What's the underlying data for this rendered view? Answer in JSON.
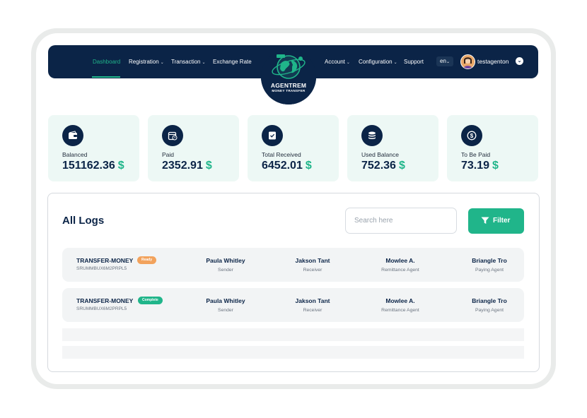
{
  "nav": {
    "left": [
      {
        "label": "Dashboard",
        "has_menu": false,
        "active": true
      },
      {
        "label": "Registration",
        "has_menu": true,
        "active": false
      },
      {
        "label": "Transaction",
        "has_menu": true,
        "active": false
      },
      {
        "label": "Exchange Rate",
        "has_menu": false,
        "active": false
      }
    ],
    "right": [
      {
        "label": "Account",
        "has_menu": true
      },
      {
        "label": "Configuration",
        "has_menu": true
      },
      {
        "label": "Support",
        "has_menu": false
      }
    ],
    "language": "en",
    "username": "testagenton",
    "logo": {
      "name": "AGENTREM",
      "tagline": "MONEY TRANSFER"
    },
    "colors": {
      "navbar": "#0b2447",
      "accent": "#20b58a"
    }
  },
  "stats": [
    {
      "label": "Balanced",
      "value": "151162.36",
      "currency": "$",
      "icon": "wallet-icon"
    },
    {
      "label": "Paid",
      "value": "2352.91",
      "currency": "$",
      "icon": "calendar-check-icon"
    },
    {
      "label": "Total Received",
      "value": "6452.01",
      "currency": "$",
      "icon": "receipt-icon"
    },
    {
      "label": "Used Balance",
      "value": "752.36",
      "currency": "$",
      "icon": "coins-stack-icon"
    },
    {
      "label": "To Be Paid",
      "value": "73.19",
      "currency": "$",
      "icon": "dollar-coin-icon"
    }
  ],
  "logs": {
    "title": "All Logs",
    "search_placeholder": "Search here",
    "filter_label": "Filter",
    "rows": [
      {
        "type": "TRANSFER-MONEY",
        "id": "SRUMMBUX6M2PRPL5",
        "status": "Ready",
        "status_color": "#f2a25c",
        "sender": {
          "name": "Paula Whitley",
          "role": "Sender"
        },
        "receiver": {
          "name": "Jakson Tant",
          "role": "Receiver"
        },
        "agent": {
          "name": "Mowlee A.",
          "role": "Remittance Agent"
        },
        "paying": {
          "name": "Briangle Tro",
          "role": "Paying Agent"
        }
      },
      {
        "type": "TRANSFER-MONEY",
        "id": "SRUMMBUX6M2PRPL5",
        "status": "Complete",
        "status_color": "#20b58a",
        "sender": {
          "name": "Paula Whitley",
          "role": "Sender"
        },
        "receiver": {
          "name": "Jakson Tant",
          "role": "Receiver"
        },
        "agent": {
          "name": "Mowlee A.",
          "role": "Remittance Agent"
        },
        "paying": {
          "name": "Briangle Tro",
          "role": "Paying Agent"
        }
      }
    ]
  }
}
